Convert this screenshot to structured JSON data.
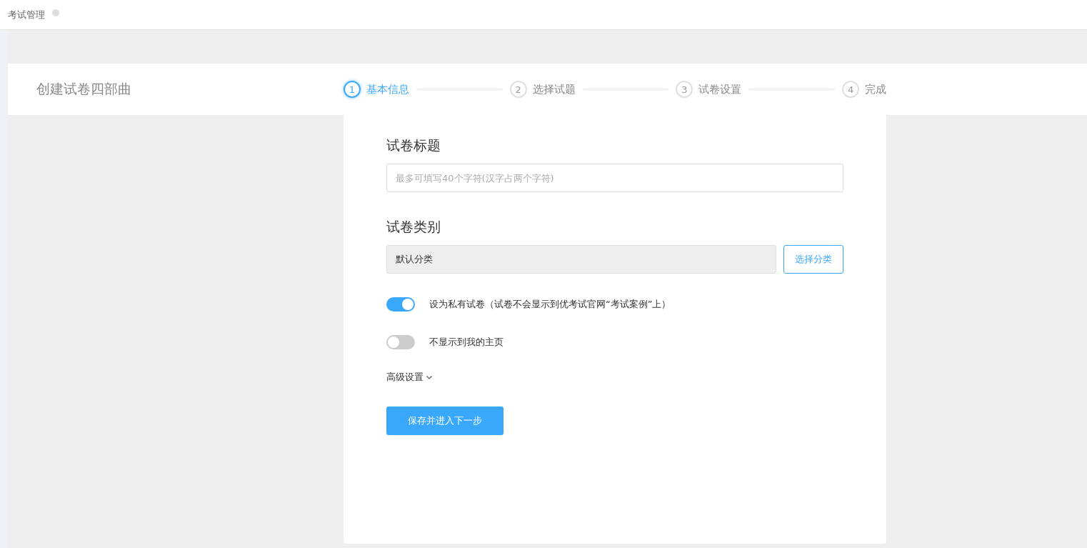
{
  "top_bar": {
    "title": "考试管理"
  },
  "header": {
    "title": "创建试卷四部曲"
  },
  "steps": [
    {
      "number": "1",
      "label": "基本信息",
      "selected": true
    },
    {
      "number": "2",
      "label": "选择试题",
      "selected": false
    },
    {
      "number": "3",
      "label": "试卷设置",
      "selected": false
    },
    {
      "number": "4",
      "label": "完成",
      "selected": false
    }
  ],
  "form": {
    "title_label": "试卷标题",
    "title_placeholder": "最多可填写40个字符(汉字占两个字符)",
    "category_label": "试卷类别",
    "category_value": "默认分类",
    "category_button": "选择分类",
    "toggles": [
      {
        "label": "设为私有试卷（试卷不会显示到优考试官网“考试案例”上）",
        "on": true
      },
      {
        "label": "不显示到我的主页",
        "on": false
      }
    ],
    "advanced": "高级设置",
    "submit": "保存并进入下一步"
  }
}
